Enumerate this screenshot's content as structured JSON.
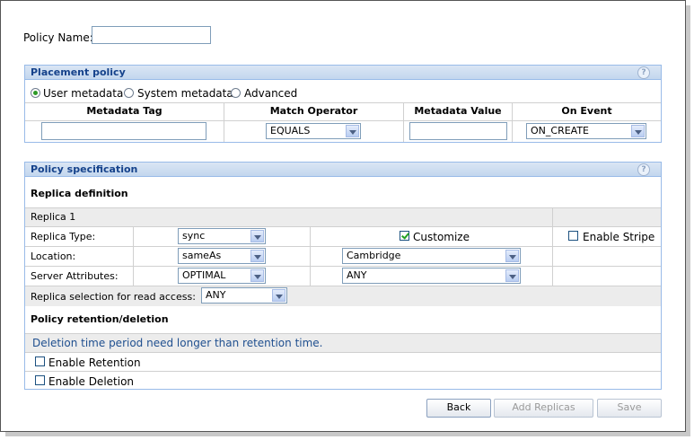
{
  "policy_name": {
    "label": "Policy Name:",
    "value": ""
  },
  "placement": {
    "title": "Placement policy",
    "help_icon": "help-icon",
    "radios": [
      {
        "label": "User metadata",
        "selected": true
      },
      {
        "label": "System metadata",
        "selected": false
      },
      {
        "label": "Advanced",
        "selected": false
      }
    ],
    "columns": [
      "Metadata Tag",
      "Match Operator",
      "Metadata Value",
      "On Event"
    ],
    "row": {
      "tag": "",
      "operator": "EQUALS",
      "value": "",
      "event": "ON_CREATE"
    }
  },
  "spec": {
    "title": "Policy specification",
    "replica_definition": "Replica definition",
    "replica_name": "Replica 1",
    "replica_type": {
      "label": "Replica Type:",
      "value": "sync"
    },
    "customize": {
      "label": "Customize",
      "checked": true
    },
    "enable_stripe": {
      "label": "Enable Stripe",
      "checked": false
    },
    "location": {
      "label": "Location:",
      "value": "sameAs",
      "site": "Cambridge"
    },
    "server_attributes": {
      "label": "Server Attributes:",
      "value": "OPTIMAL",
      "site_value": "ANY"
    },
    "read_access": {
      "label": "Replica selection for read access:",
      "value": "ANY"
    },
    "retention": {
      "title": "Policy retention/deletion",
      "note": "Deletion time period need longer than retention time.",
      "enable_retention": {
        "label": "Enable Retention",
        "checked": false
      },
      "enable_deletion": {
        "label": "Enable Deletion",
        "checked": false
      }
    }
  },
  "buttons": {
    "back": "Back",
    "add_replicas": "Add Replicas",
    "save": "Save"
  },
  "colors": {
    "header_text": "#15428b",
    "panel_border": "#99bbe8",
    "note_text": "#1f4f8f"
  }
}
